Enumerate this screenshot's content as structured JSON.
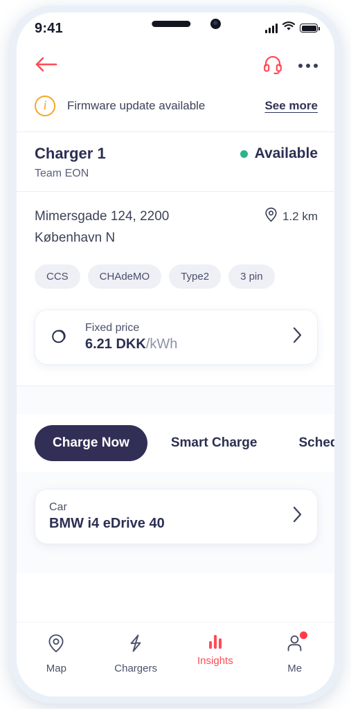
{
  "status_bar": {
    "time": "9:41",
    "cellular_icon": "signal-bars-icon",
    "wifi_icon": "wifi-icon",
    "battery_icon": "battery-full-icon"
  },
  "header": {
    "back_icon": "back-arrow-icon",
    "support_icon": "headset-icon",
    "more_icon": "more-options-icon"
  },
  "banner": {
    "icon": "info-circle-icon",
    "message": "Firmware update available",
    "action_label": "See more",
    "accent_color": "#f5a623"
  },
  "charger": {
    "name": "Charger 1",
    "status": "Available",
    "status_color": "#29b48a",
    "status_dot_icon": "status-dot-icon",
    "team": "Team EON"
  },
  "location": {
    "address_line1": "Mimersgade 124, 2200",
    "address_line2": "København N",
    "distance": "1.2 km",
    "pin_icon": "location-pin-icon",
    "connectors": [
      "CCS",
      "CHAdeMO",
      "Type2",
      "3 pin"
    ]
  },
  "price_card": {
    "icon": "coins-icon",
    "label": "Fixed price",
    "amount": "6.21 DKK",
    "unit": "/kWh",
    "chevron_icon": "chevron-right-icon"
  },
  "tabs": [
    {
      "label": "Charge Now",
      "active": true
    },
    {
      "label": "Smart Charge",
      "active": false
    },
    {
      "label": "Schedule",
      "active": false
    }
  ],
  "car_card": {
    "label": "Car",
    "value": "BMW i4 eDrive 40",
    "chevron_icon": "chevron-right-icon"
  },
  "bottom_nav": {
    "active_color": "#ff4b55",
    "items": [
      {
        "label": "Map",
        "icon": "map-pin-icon",
        "active": false,
        "badge": false
      },
      {
        "label": "Chargers",
        "icon": "lightning-bolt-icon",
        "active": false,
        "badge": false
      },
      {
        "label": "Insights",
        "icon": "bar-chart-icon",
        "active": true,
        "badge": false
      },
      {
        "label": "Me",
        "icon": "person-icon",
        "active": false,
        "badge": true
      }
    ]
  }
}
